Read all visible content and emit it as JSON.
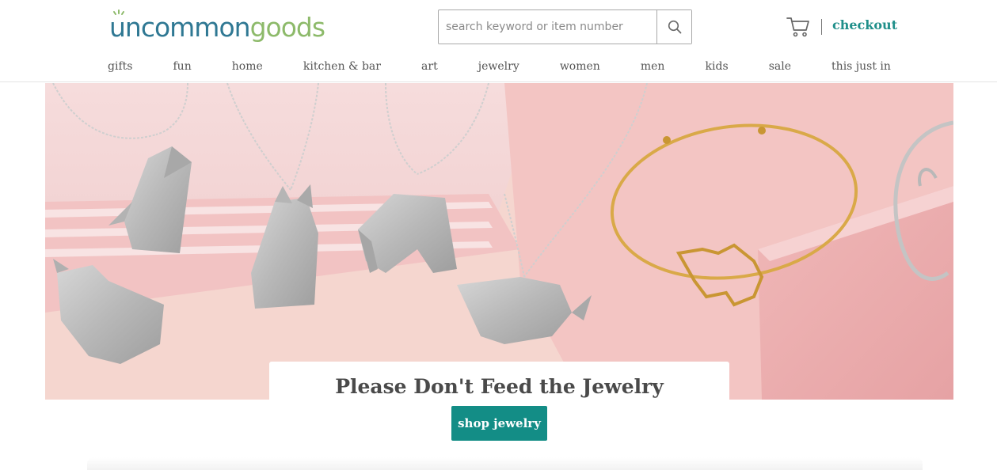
{
  "header": {
    "logo": {
      "part1": "uncommon",
      "part2": "goods"
    },
    "search": {
      "placeholder": "search keyword or item number",
      "value": "",
      "icon": "search-icon"
    },
    "cart": {
      "icon": "cart-icon"
    },
    "checkout_label": "checkout"
  },
  "nav": {
    "items": [
      {
        "label": "gifts"
      },
      {
        "label": "fun"
      },
      {
        "label": "home"
      },
      {
        "label": "kitchen & bar"
      },
      {
        "label": "art"
      },
      {
        "label": "jewelry"
      },
      {
        "label": "women"
      },
      {
        "label": "men"
      },
      {
        "label": "kids"
      },
      {
        "label": "sale"
      },
      {
        "label": "this just in"
      }
    ]
  },
  "hero": {
    "caption": "Please Don't Feed the Jewelry",
    "cta_label": "shop jewelry"
  },
  "colors": {
    "brand_blue": "#2f7893",
    "brand_green": "#8dba6a",
    "accent_teal": "#138d86",
    "checkout_teal": "#1f8f8a"
  }
}
